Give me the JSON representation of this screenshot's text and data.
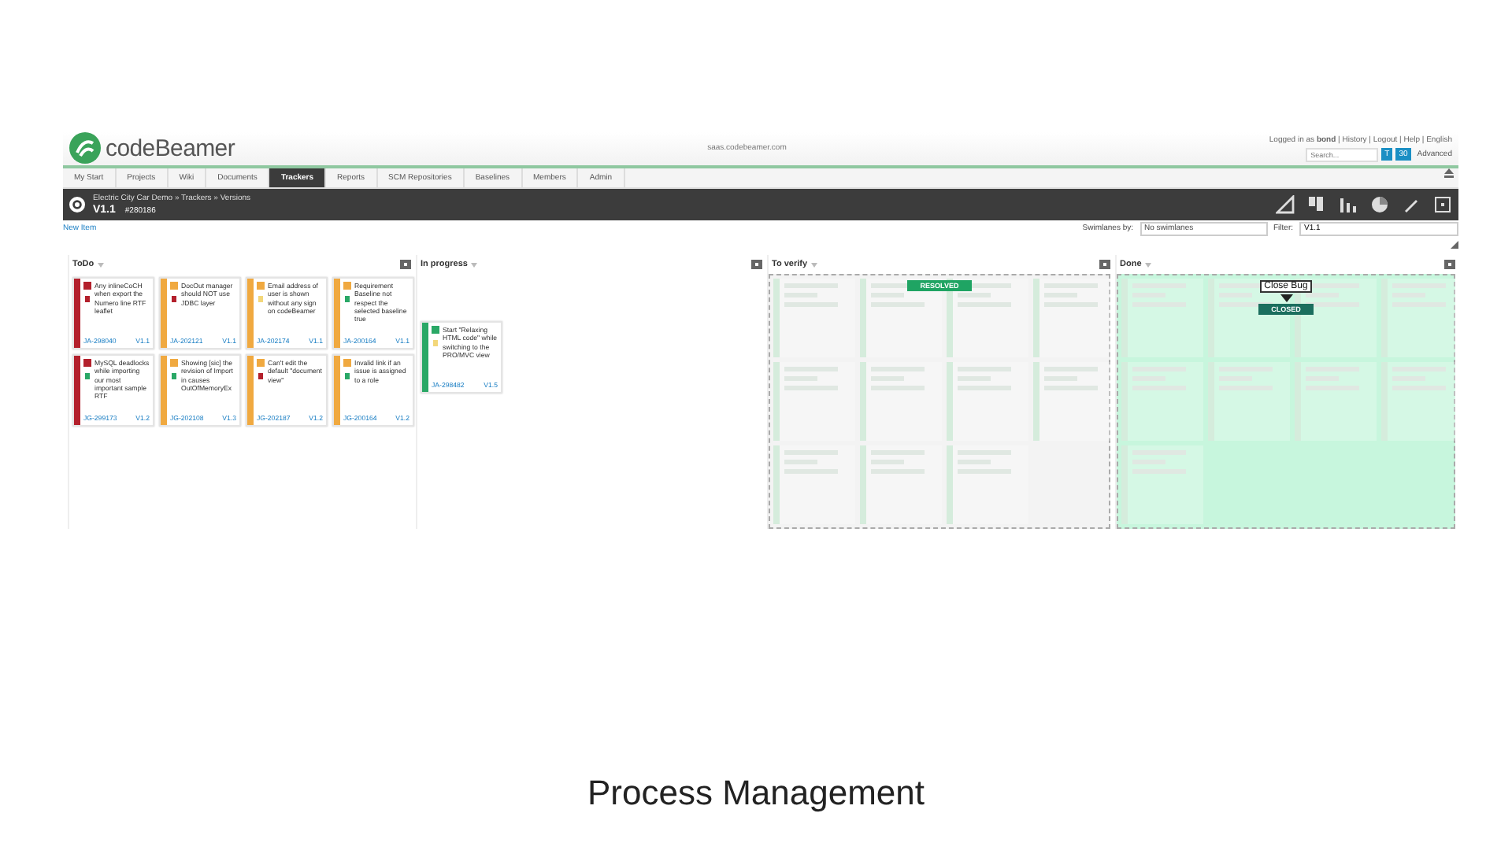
{
  "header": {
    "logo": "codeBeamer",
    "url": "saas.codebeamer.com",
    "user_line": "Logged in as **bond** | History | Logout | Help | English",
    "search": {
      "placeholder": "Search..."
    },
    "search_buttons": [
      "T",
      "30"
    ],
    "advanced": "Advanced"
  },
  "nav": [
    {
      "label": "My Start",
      "selected": false
    },
    {
      "label": "Projects",
      "selected": false
    },
    {
      "label": "Wiki",
      "selected": false
    },
    {
      "label": "Documents",
      "selected": false
    },
    {
      "label": "Trackers",
      "selected": true
    },
    {
      "label": "Reports",
      "selected": false
    },
    {
      "label": "SCM Repositories",
      "selected": false
    },
    {
      "label": "Baselines",
      "selected": false
    },
    {
      "label": "Members",
      "selected": false
    },
    {
      "label": "Admin",
      "selected": false
    }
  ],
  "titlebar": {
    "breadcrumb": "Electric City Car Demo » Trackers » Versions",
    "title": "V1.1",
    "item_id": "#280186"
  },
  "toolbar": {
    "new_item": "New Item",
    "swimlanes_label": "Swimlanes by:",
    "swimlanes_value": "No swimlanes",
    "filter_label": "Filter:",
    "filter_value": "V1.1"
  },
  "columns": [
    {
      "title": "ToDo",
      "kind": "normal",
      "cards": [
        {
          "text": "Any inlineCoCH when export the Numero line RTF leaflet",
          "id": "JA-298040",
          "version": "V1.1",
          "color": "#b3202c",
          "flag": {
            "color": "#b3202c"
          }
        },
        {
          "text": "DocOut manager should NOT use JDBC layer",
          "id": "JA-202121",
          "version": "V1.1",
          "color": "#f0a940",
          "flag": {
            "color": "#b3202c"
          }
        },
        {
          "text": "Email address of user is shown without any sign on codeBeamer",
          "id": "JA-202174",
          "version": "V1.1",
          "color": "#f0a940",
          "flag": {
            "color": "#f3d77a"
          }
        },
        {
          "text": "Requirement Baseline not respect the selected baseline true",
          "id": "JA-200164",
          "version": "V1.1",
          "color": "#f0a940",
          "flag": {
            "color": "#2aa866"
          }
        },
        {
          "text": "MySQL deadlocks while importing our most important sample RTF",
          "id": "JG-299173",
          "version": "V1.2",
          "color": "#b3202c",
          "flag": {
            "color": "#2aa866"
          }
        },
        {
          "text": "Showing [sic] the revision of Import in causes OutOfMemoryEx",
          "id": "JG-202108",
          "version": "V1.3",
          "color": "#f0a940",
          "flag": {
            "color": "#2aa866"
          }
        },
        {
          "text": "Can't edit the default \"document view\"",
          "id": "JG-202187",
          "version": "V1.2",
          "color": "#f0a940",
          "flag": {
            "color": "#b3202c"
          }
        },
        {
          "text": "Invalid link if an issue is assigned to a role",
          "id": "JG-200164",
          "version": "V1.2",
          "color": "#f0a940",
          "flag": {
            "color": "#2aa866"
          }
        }
      ]
    },
    {
      "title": "In progress",
      "kind": "normal",
      "cards": [
        {
          "text": "Start \"Relaxing HTML code\" while switching to the PRO/MVC view",
          "id": "JA-298482",
          "version": "V1.5",
          "color": "#2aa866",
          "flag": {
            "color": "#f3d77a"
          }
        }
      ]
    },
    {
      "title": "To verify",
      "kind": "target",
      "overlay": {
        "badge": "RESOLVED"
      },
      "ghost_cards": [
        {
          "kind": "ghost"
        },
        {
          "kind": "ghost"
        },
        {
          "kind": "ghost"
        },
        {
          "kind": "ghost"
        },
        {
          "kind": "ghost"
        },
        {
          "kind": "ghost"
        },
        {
          "kind": "ghost"
        },
        {
          "kind": "ghost"
        },
        {
          "kind": "ghost"
        },
        {
          "kind": "ghost"
        },
        {
          "kind": "ghost"
        }
      ]
    },
    {
      "title": "Done",
      "kind": "done",
      "overlay": {
        "tooltip": "Close Bug",
        "badge": "CLOSED"
      },
      "ghost_cards": [
        {
          "kind": "ghost"
        },
        {
          "kind": "ghost"
        },
        {
          "kind": "ghost"
        },
        {
          "kind": "ghost"
        },
        {
          "kind": "ghost"
        },
        {
          "kind": "ghost"
        },
        {
          "kind": "ghost"
        },
        {
          "kind": "ghost"
        },
        {
          "kind": "ghost"
        }
      ]
    }
  ],
  "caption": "Process Management"
}
